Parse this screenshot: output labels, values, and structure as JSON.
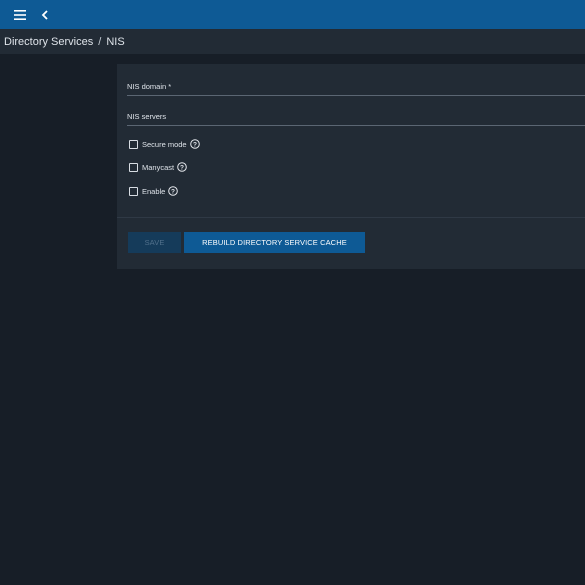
{
  "topbar": {
    "menu_icon": "menu-icon",
    "back_icon": "chevron-left-icon",
    "color": "#0e5a95"
  },
  "breadcrumb": {
    "items": [
      "Directory Services",
      "NIS"
    ],
    "separator": "/"
  },
  "form": {
    "nis_domain": {
      "label": "NIS domain *",
      "value": ""
    },
    "nis_servers": {
      "label": "NIS servers",
      "value": ""
    },
    "checkboxes": [
      {
        "label": "Secure mode",
        "checked": false,
        "help_icon": "help-circle-icon"
      },
      {
        "label": "Manycast",
        "checked": false,
        "help_icon": "help-circle-icon"
      },
      {
        "label": "Enable",
        "checked": false,
        "help_icon": "help-circle-icon"
      }
    ],
    "buttons": {
      "save": "SAVE",
      "rebuild": "REBUILD DIRECTORY SERVICE CACHE"
    }
  },
  "colors": {
    "background": "#171e27",
    "panel": "#222b35",
    "accent": "#0e5a95",
    "disabled_button": "#153b5a"
  }
}
